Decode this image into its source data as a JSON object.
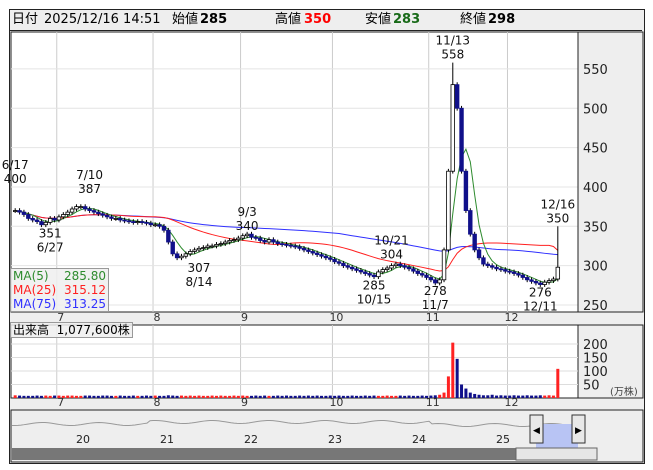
{
  "header": {
    "date_label": "日付",
    "date": "2025/12/16 14:51",
    "open_label": "始値",
    "open": "285",
    "high_label": "高値",
    "high": "350",
    "low_label": "安値",
    "low": "283",
    "close_label": "終値",
    "close": "298"
  },
  "ma_legend": [
    {
      "label": "MA(5)",
      "value": "285.80",
      "color": "#2e8b2e"
    },
    {
      "label": "MA(25)",
      "value": "315.12",
      "color": "#ff2020"
    },
    {
      "label": "MA(75)",
      "value": "313.25",
      "color": "#3030ff"
    }
  ],
  "volume_legend": {
    "label": "出来高",
    "value": "1,077,600株"
  },
  "volume_unit": "(万株)",
  "navigator_labels": [
    "20",
    "21",
    "22",
    "23",
    "24",
    "25"
  ],
  "chart_data": {
    "type": "candlestick",
    "price_ticks": [
      250,
      300,
      350,
      400,
      450,
      500,
      550
    ],
    "price_range": [
      240,
      590
    ],
    "volume_ticks": [
      50,
      100,
      150,
      200
    ],
    "volume_range": [
      0,
      250
    ],
    "month_labels": [
      {
        "label": "7",
        "index": 10
      },
      {
        "label": "8",
        "index": 32
      },
      {
        "label": "9",
        "index": 52
      },
      {
        "label": "10",
        "index": 73
      },
      {
        "label": "11",
        "index": 95
      },
      {
        "label": "12",
        "index": 113
      }
    ],
    "closes": [
      370,
      368,
      365,
      360,
      358,
      356,
      352,
      355,
      360,
      358,
      362,
      365,
      368,
      372,
      375,
      375,
      372,
      370,
      368,
      366,
      364,
      362,
      360,
      360,
      358,
      357,
      356,
      355,
      356,
      355,
      354,
      352,
      352,
      350,
      345,
      330,
      315,
      310,
      312,
      315,
      318,
      320,
      322,
      323,
      325,
      325,
      327,
      328,
      330,
      332,
      333,
      335,
      338,
      340,
      336,
      335,
      332,
      330,
      333,
      330,
      328,
      327,
      326,
      325,
      324,
      322,
      320,
      318,
      316,
      314,
      312,
      310,
      308,
      305,
      303,
      300,
      298,
      296,
      294,
      292,
      290,
      288,
      286,
      292,
      295,
      297,
      300,
      302,
      300,
      298,
      296,
      293,
      290,
      288,
      285,
      282,
      278,
      282,
      320,
      420,
      530,
      500,
      420,
      370,
      340,
      320,
      310,
      302,
      300,
      298,
      296,
      295,
      293,
      292,
      290,
      288,
      285,
      282,
      280,
      278,
      276,
      279,
      281,
      283,
      298
    ],
    "volumes": [
      10,
      9,
      8,
      8,
      8,
      9,
      8,
      9,
      8,
      9,
      9,
      8,
      9,
      9,
      8,
      8,
      9,
      9,
      8,
      8,
      9,
      9,
      8,
      8,
      9,
      8,
      8,
      9,
      8,
      8,
      9,
      8,
      9,
      8,
      8,
      10,
      9,
      8,
      9,
      8,
      9,
      8,
      9,
      8,
      8,
      9,
      8,
      9,
      8,
      8,
      9,
      8,
      9,
      8,
      8,
      9,
      8,
      9,
      8,
      8,
      9,
      8,
      9,
      8,
      8,
      9,
      8,
      9,
      8,
      9,
      8,
      8,
      9,
      8,
      9,
      8,
      8,
      9,
      8,
      8,
      9,
      8,
      9,
      8,
      8,
      9,
      8,
      8,
      9,
      8,
      9,
      8,
      8,
      9,
      8,
      9,
      10,
      12,
      20,
      80,
      205,
      145,
      50,
      35,
      20,
      15,
      12,
      10,
      10,
      12,
      9,
      10,
      9,
      9,
      10,
      9,
      9,
      10,
      9,
      9,
      10,
      9,
      10,
      9,
      108
    ],
    "annotations": [
      {
        "label": "6/17",
        "value": "400",
        "index": 0,
        "price": 400,
        "pos": "above"
      },
      {
        "label": "7/10",
        "value": "387",
        "index": 17,
        "price": 387,
        "pos": "above"
      },
      {
        "label": "6/27",
        "value": "351",
        "index": 8,
        "price": 351,
        "pos": "below"
      },
      {
        "label": "8/14",
        "value": "307",
        "index": 42,
        "price": 307,
        "pos": "below"
      },
      {
        "label": "9/3",
        "value": "340",
        "index": 53,
        "price": 340,
        "pos": "above"
      },
      {
        "label": "10/21",
        "value": "304",
        "index": 86,
        "price": 304,
        "pos": "above"
      },
      {
        "label": "10/15",
        "value": "285",
        "index": 82,
        "price": 285,
        "pos": "below"
      },
      {
        "label": "11/7",
        "value": "278",
        "index": 96,
        "price": 278,
        "pos": "below"
      },
      {
        "label": "11/13",
        "value": "558",
        "index": 100,
        "price": 558,
        "pos": "above"
      },
      {
        "label": "12/11",
        "value": "276",
        "index": 120,
        "price": 276,
        "pos": "below"
      },
      {
        "label": "12/16",
        "value": "350",
        "index": 124,
        "price": 350,
        "pos": "above"
      }
    ]
  }
}
